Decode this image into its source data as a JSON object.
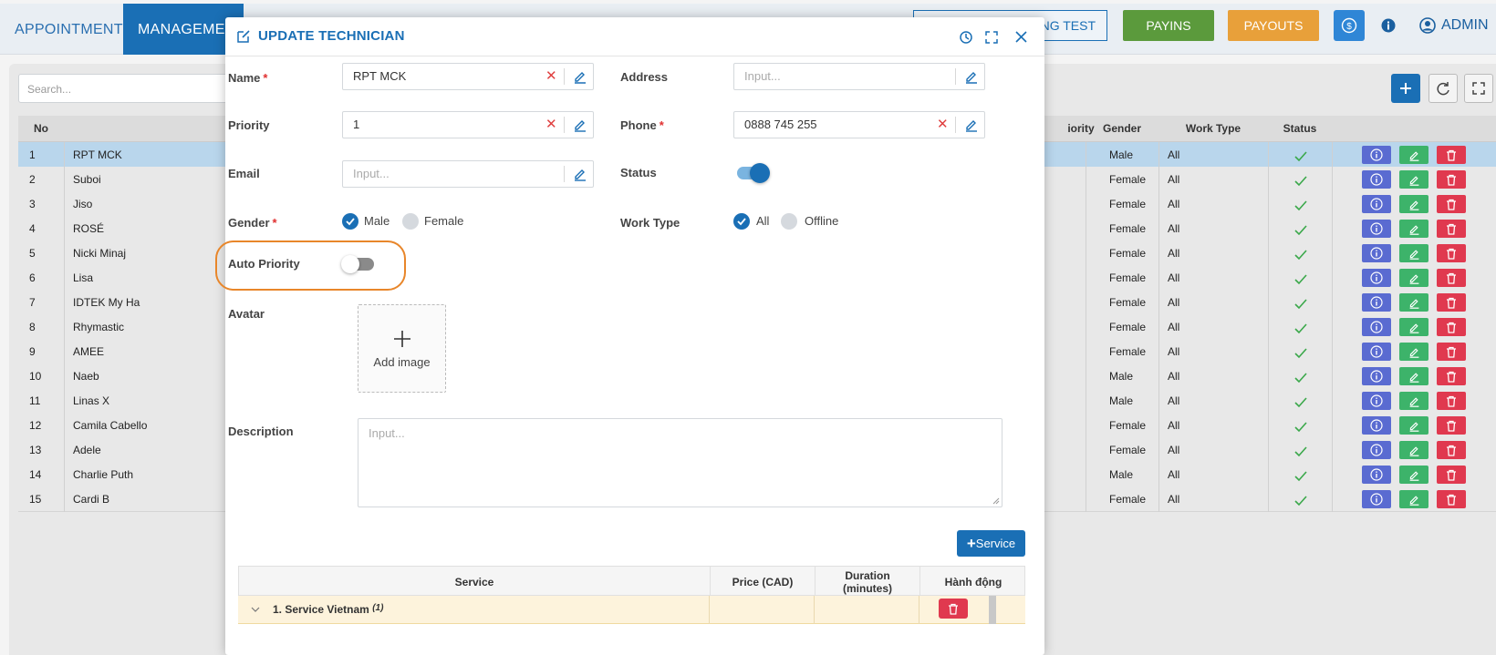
{
  "nav": {
    "tabs": [
      "APPOINTMENT",
      "MANAGEMENT"
    ],
    "test_label": "ING TEST",
    "payins": "PAYINS",
    "payouts": "PAYOUTS",
    "admin": "ADMIN"
  },
  "colors": {
    "primary": "#1a6fb5",
    "payins": "#5b9a3c",
    "payouts": "#e8a03a",
    "danger": "#e0394f",
    "success": "#3db36a",
    "info": "#5a6bd1"
  },
  "list": {
    "search_placeholder": "Search...",
    "columns": {
      "no": "No",
      "priority": "iority",
      "gender": "Gender",
      "work_type": "Work Type",
      "status": "Status"
    },
    "rows": [
      {
        "no": "1",
        "name": "RPT MCK",
        "gender": "Male",
        "work": "All"
      },
      {
        "no": "2",
        "name": "Suboi",
        "gender": "Female",
        "work": "All"
      },
      {
        "no": "3",
        "name": "Jiso",
        "gender": "Female",
        "work": "All"
      },
      {
        "no": "4",
        "name": "ROSÉ",
        "gender": "Female",
        "work": "All"
      },
      {
        "no": "5",
        "name": "Nicki Minaj",
        "gender": "Female",
        "work": "All"
      },
      {
        "no": "6",
        "name": "Lisa",
        "gender": "Female",
        "work": "All"
      },
      {
        "no": "7",
        "name": "IDTEK My Ha",
        "gender": "Female",
        "work": "All"
      },
      {
        "no": "8",
        "name": "Rhymastic",
        "gender": "Female",
        "work": "All"
      },
      {
        "no": "9",
        "name": "AMEE",
        "gender": "Female",
        "work": "All"
      },
      {
        "no": "10",
        "name": "Naeb",
        "gender": "Male",
        "work": "All"
      },
      {
        "no": "11",
        "name": "Linas X",
        "gender": "Male",
        "work": "All"
      },
      {
        "no": "12",
        "name": "Camila Cabello",
        "gender": "Female",
        "work": "All"
      },
      {
        "no": "13",
        "name": "Adele",
        "gender": "Female",
        "work": "All"
      },
      {
        "no": "14",
        "name": "Charlie Puth",
        "gender": "Male",
        "work": "All"
      },
      {
        "no": "15",
        "name": "Cardi B",
        "gender": "Female",
        "work": "All"
      }
    ]
  },
  "modal": {
    "title": "UPDATE TECHNICIAN",
    "name_label": "Name",
    "name_value": "RPT MCK",
    "address_label": "Address",
    "address_placeholder": "Input...",
    "priority_label": "Priority",
    "priority_value": "1",
    "phone_label": "Phone",
    "phone_value": "0888 745 255",
    "email_label": "Email",
    "email_placeholder": "Input...",
    "status_label": "Status",
    "status_on": true,
    "gender_label": "Gender",
    "gender_male": "Male",
    "gender_female": "Female",
    "worktype_label": "Work Type",
    "worktype_all": "All",
    "worktype_offline": "Offline",
    "auto_priority_label": "Auto Priority",
    "auto_priority_on": false,
    "avatar_label": "Avatar",
    "add_image": "Add image",
    "description_label": "Description",
    "description_placeholder": "Input...",
    "required_mark": "*",
    "service_button": "Service",
    "service_table": {
      "col_service": "Service",
      "col_price": "Price (CAD)",
      "col_duration": "Duration (minutes)",
      "col_action": "Hành động",
      "row_label": "1. Service Vietnam",
      "row_count": "(1)"
    }
  }
}
